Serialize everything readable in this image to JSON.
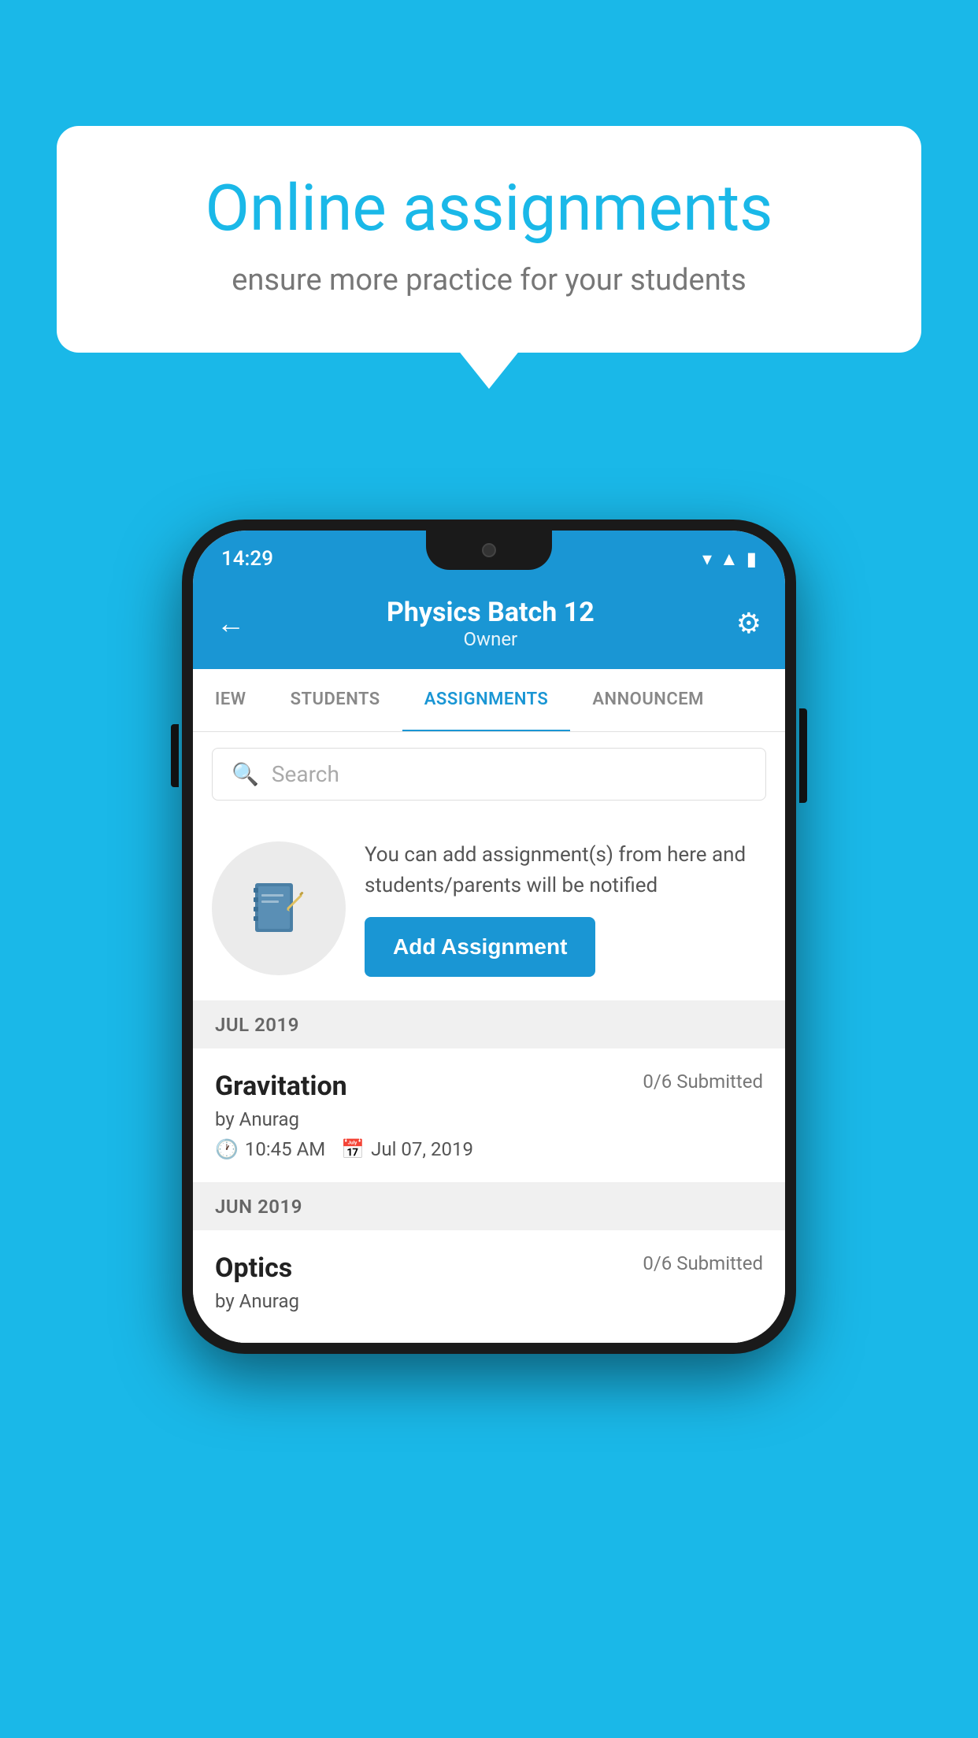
{
  "background_color": "#1ab8e8",
  "speech_bubble": {
    "title": "Online assignments",
    "subtitle": "ensure more practice for your students"
  },
  "phone": {
    "status_bar": {
      "time": "14:29",
      "icons": [
        "wifi",
        "signal",
        "battery"
      ]
    },
    "header": {
      "title": "Physics Batch 12",
      "subtitle": "Owner",
      "back_label": "←",
      "settings_label": "⚙"
    },
    "tabs": [
      {
        "label": "IEW",
        "active": false
      },
      {
        "label": "STUDENTS",
        "active": false
      },
      {
        "label": "ASSIGNMENTS",
        "active": true
      },
      {
        "label": "ANNOUNCEM",
        "active": false
      }
    ],
    "search": {
      "placeholder": "Search"
    },
    "promo": {
      "text": "You can add assignment(s) from here and students/parents will be notified",
      "button_label": "Add Assignment"
    },
    "sections": [
      {
        "month": "JUL 2019",
        "assignments": [
          {
            "name": "Gravitation",
            "submitted": "0/6 Submitted",
            "by": "by Anurag",
            "time": "10:45 AM",
            "date": "Jul 07, 2019"
          }
        ]
      },
      {
        "month": "JUN 2019",
        "assignments": [
          {
            "name": "Optics",
            "submitted": "0/6 Submitted",
            "by": "by Anurag",
            "time": "",
            "date": ""
          }
        ]
      }
    ]
  }
}
